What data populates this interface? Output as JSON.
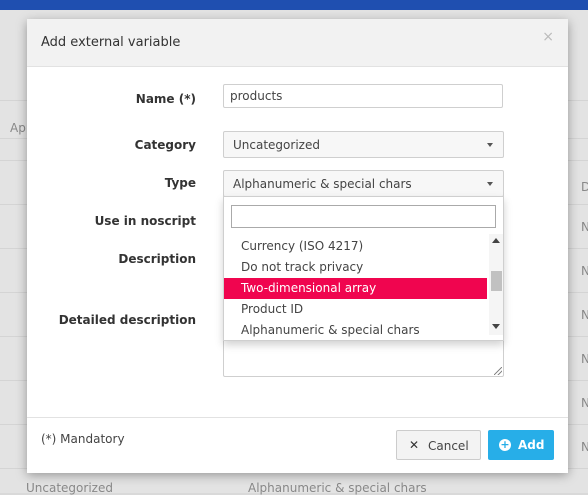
{
  "background": {
    "frag_apps": "App",
    "frag_col": "D",
    "frag_n": "N",
    "bottom_category": "Uncategorized",
    "bottom_type": "Alphanumeric & special chars"
  },
  "modal": {
    "title": "Add external variable",
    "close": "×"
  },
  "form": {
    "name_label": "Name (*)",
    "name_value": "products",
    "category_label": "Category",
    "category_value": "Uncategorized",
    "type_label": "Type",
    "type_value": "Alphanumeric & special chars",
    "noscript_label": "Use in noscript",
    "description_label": "Description",
    "detailed_label": "Detailed description"
  },
  "dropdown": {
    "search_value": "",
    "options": [
      "Currency (ISO 4217)",
      "Do not track privacy",
      "Two-dimensional array",
      "Product ID",
      "Alphanumeric & special chars"
    ],
    "selected_index": 2
  },
  "footer": {
    "mandatory": "(*) Mandatory",
    "cancel_label": "Cancel",
    "add_label": "Add"
  },
  "colors": {
    "accent_primary": "#27aee8",
    "selected_option": "#f0054f",
    "top_bar": "#1f4fb0"
  }
}
